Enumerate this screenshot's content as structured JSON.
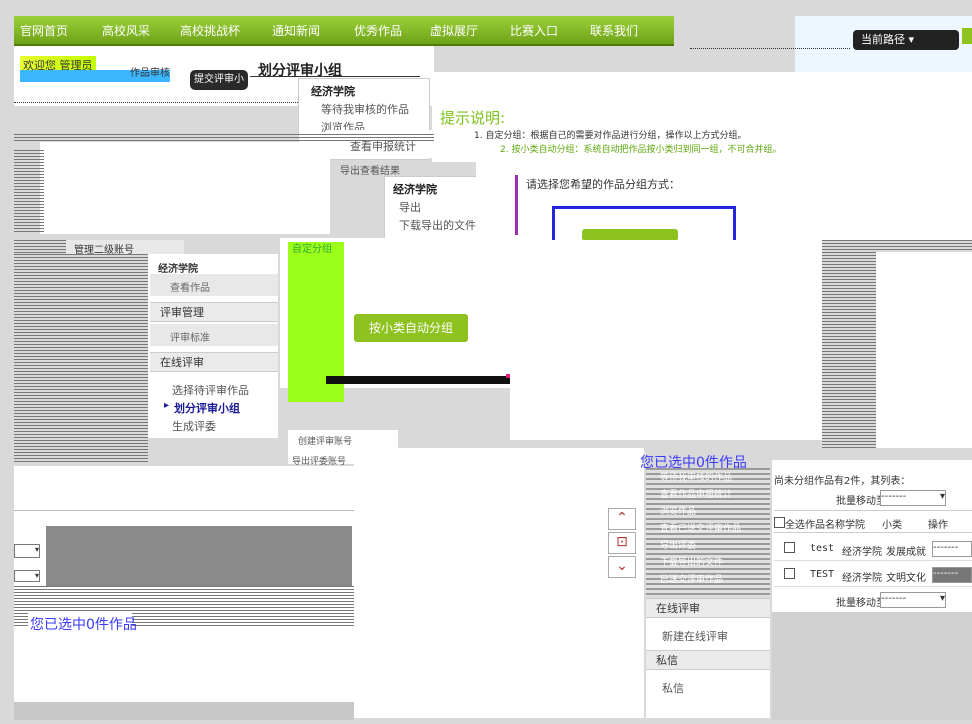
{
  "nav": {
    "items": [
      "官网首页",
      "高校风采",
      "高校挑战杯",
      "通知新闻",
      "优秀作品",
      "虚拟展厅",
      "比赛入口",
      "联系我们"
    ]
  },
  "header": {
    "crumb": "当前路径 ▾",
    "tag_yellow": "欢迎您 管理员",
    "sidebar_top_label": "作品审核",
    "pill_label": "提交评审小组",
    "page_title": "划分评审小组"
  },
  "dropdown_menu1": {
    "title": "经济学院",
    "items": [
      "等待我审核的作品",
      "浏览作品"
    ],
    "extra": "查看申报统计",
    "export": "导出查看结果"
  },
  "dropdown_menu2": {
    "title": "经济学院",
    "items": [
      "导出",
      "下载导出的文件"
    ]
  },
  "hint": {
    "title": "提示说明:",
    "line1": "1. 自定分组：根据自己的需要对作品进行分组，操作以上方式分组。",
    "line2": "2. 按小类自动分组：系统自动把作品按小类归到同一组，不可合并组。",
    "question": "请选择您希望的作品分组方式："
  },
  "account": {
    "label": "管理二级账号"
  },
  "left_menu": {
    "college": "经济学院",
    "college_item": "查看作品",
    "section_review_mgmt": "评审管理",
    "review_mgmt_item": "评审标准",
    "section_online_review": "在线评审",
    "items": [
      "选择待评审作品",
      "划分评审小组",
      "生成评委"
    ],
    "active_index": 1
  },
  "group_panel": {
    "custom_label": "自定分组",
    "auto_button": "按小类自动分组",
    "import_label": "创建评审账号",
    "export_label": "导出评委账号"
  },
  "selected_left": "您已选中0件作品",
  "selected_right": "您已选中0件作品",
  "right_nav": {
    "items": [
      "等待我审核的作品",
      "查看作品申报统计",
      "浏览作品",
      "查看已送交评审作品",
      "导出评委",
      "下载导出的文件",
      "已送交评审作品"
    ],
    "section_online_review": "在线评审",
    "online_review_item": "新建在线评审",
    "section_message": "私信",
    "message_item": "私信"
  },
  "table": {
    "summary": "尚未分组作品有2件，其列表：",
    "batch_move_label": "批量移动至",
    "batch_select_value": "-------",
    "headers": [
      "全选",
      "作品名称",
      "学院",
      "小类",
      "操作"
    ],
    "rows": [
      {
        "name": "test",
        "college": "经济学院",
        "category": "发展成就",
        "select": "-------"
      },
      {
        "name": "TEST",
        "college": "经济学院",
        "category": "文明文化",
        "select": "-------"
      }
    ],
    "batch_move_label_bottom": "批量移动至",
    "batch_select_value_bottom": "-------"
  },
  "colors": {
    "nav_green": "#8fc31f",
    "accent_blue": "#3a3aff",
    "hint_green": "#7cc21a"
  }
}
